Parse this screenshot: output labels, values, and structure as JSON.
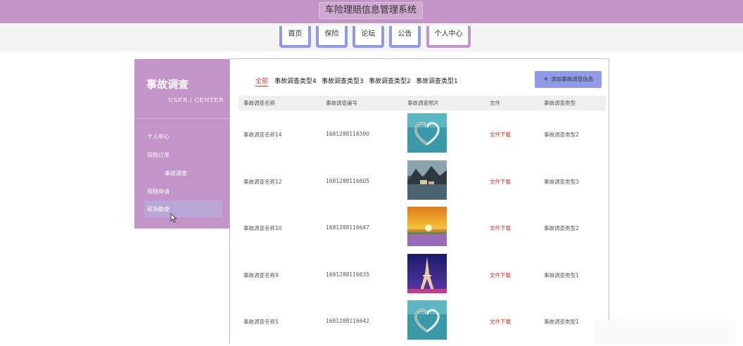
{
  "header": {
    "site_title": "车险理赔信息管理系统"
  },
  "nav": {
    "items": [
      {
        "label": "首页"
      },
      {
        "label": "保险"
      },
      {
        "label": "论坛"
      },
      {
        "label": "公告"
      },
      {
        "label": "个人中心"
      }
    ]
  },
  "sidebar": {
    "title": "事故调查",
    "subtitle": "USER / CENTER",
    "items": [
      {
        "label": "个人中心"
      },
      {
        "label": "保险订单"
      },
      {
        "label": "事故调查"
      },
      {
        "label": "理赔申请"
      },
      {
        "label": "现场勘查"
      }
    ]
  },
  "tabs": [
    {
      "label": "全部"
    },
    {
      "label": "事故调查类型4"
    },
    {
      "label": "事故调查类型3"
    },
    {
      "label": "事故调查类型2"
    },
    {
      "label": "事故调查类型1"
    }
  ],
  "add_button": {
    "icon": "plus-icon",
    "label": "添加事故调查信息"
  },
  "table": {
    "headers": [
      "事故调查名称",
      "事故调查编号",
      "事故调查照片",
      "文件",
      "事故调查类型"
    ],
    "rows": [
      {
        "name": "事故调查名称14",
        "code": "1681288116590",
        "photo": "heart-island",
        "file": "文件下载",
        "type": "事故调查类型2"
      },
      {
        "name": "事故调查名称12",
        "code": "1681288116605",
        "photo": "mountain-lake",
        "file": "文件下载",
        "type": "事故调查类型3"
      },
      {
        "name": "事故调查名称10",
        "code": "1681288116647",
        "photo": "sunset-field",
        "file": "文件下载",
        "type": "事故调查类型2"
      },
      {
        "name": "事故调查名称9",
        "code": "1681288116635",
        "photo": "eiffel-tower",
        "file": "文件下载",
        "type": "事故调查类型1"
      },
      {
        "name": "事故调查名称5",
        "code": "1681288116642",
        "photo": "heart-island",
        "file": "文件下载",
        "type": "事故调查类型1"
      }
    ]
  },
  "colors": {
    "primary": "#c394c8",
    "accent": "#8f9be6",
    "link": "#d0342c"
  }
}
